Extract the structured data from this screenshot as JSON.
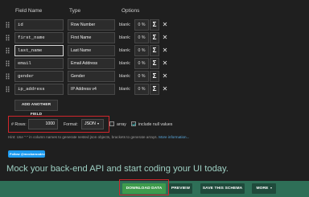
{
  "headers": {
    "field_name": "Field Name",
    "type": "Type",
    "options": "Options"
  },
  "fields": [
    {
      "name": "id",
      "type": "Row Number",
      "blank_label": "blank:",
      "blank_pct": "0 %",
      "sigma": "Σ",
      "delete": "✕"
    },
    {
      "name": "first_name",
      "type": "First Name",
      "blank_label": "blank:",
      "blank_pct": "0 %",
      "sigma": "Σ",
      "delete": "✕"
    },
    {
      "name": "last_name",
      "type": "Last Name",
      "blank_label": "blank:",
      "blank_pct": "0 %",
      "sigma": "Σ",
      "delete": "✕"
    },
    {
      "name": "email",
      "type": "Email Address",
      "blank_label": "blank:",
      "blank_pct": "0 %",
      "sigma": "Σ",
      "delete": "✕"
    },
    {
      "name": "gender",
      "type": "Gender",
      "blank_label": "blank:",
      "blank_pct": "0 %",
      "sigma": "Σ",
      "delete": "✕"
    },
    {
      "name": "ip_address",
      "type": "IP Address v4",
      "blank_label": "blank:",
      "blank_pct": "0 %",
      "sigma": "Σ",
      "delete": "✕"
    }
  ],
  "add_field_label": "ADD ANOTHER FIELD",
  "options": {
    "rows_label": "# Rows:",
    "rows_value": "1000",
    "format_label": "Format:",
    "format_value": "JSON",
    "array_label": "array",
    "array_checked": false,
    "null_label": "include null values",
    "null_checked": true
  },
  "hint": {
    "text": "Hint: Use \"·\" in column names to generate nested json objects, brackets to generate arrays.",
    "link": "More information..."
  },
  "twitter_label": "Follow @mockaroodev",
  "tagline": "Mock your back-end API and start coding your UI today.",
  "buttons": {
    "download": "DOWNLOAD DATA",
    "preview": "PREVIEW",
    "save": "SAVE THIS SCHEMA",
    "more": "MORE"
  },
  "colors": {
    "highlight": "#d0262b",
    "accent_bar": "#2e6f57",
    "download_btn": "#3e9b4c"
  }
}
